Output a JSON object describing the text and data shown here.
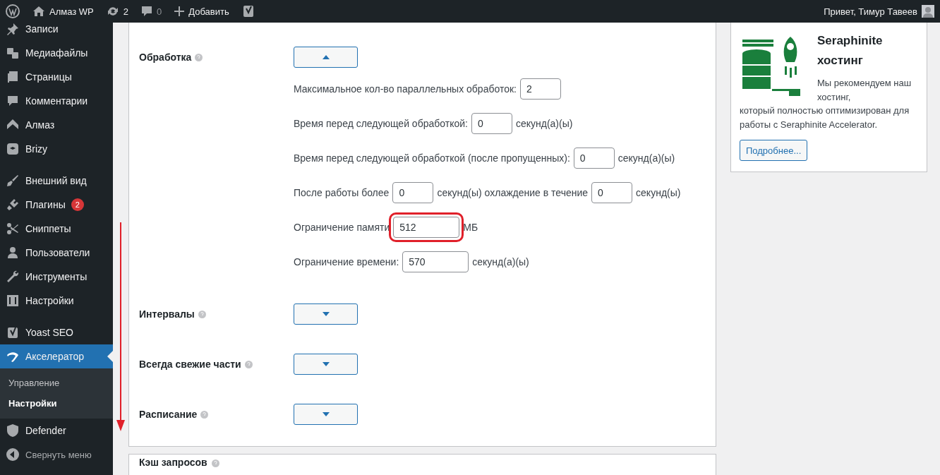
{
  "admin_bar": {
    "site_name": "Алмаз WP",
    "updates": "2",
    "comments": "0",
    "new_label": "Добавить",
    "greeting": "Привет, Тимур Тавеев"
  },
  "sidebar": {
    "sections": [
      {
        "items": [
          {
            "label": "Записи",
            "selected": false
          },
          {
            "label": "Медиафайлы",
            "selected": false
          },
          {
            "label": "Страницы",
            "selected": false
          },
          {
            "label": "Комментарии",
            "selected": false
          },
          {
            "label": "Алмаз",
            "selected": false
          },
          {
            "label": "Brizy",
            "selected": false
          }
        ]
      },
      {
        "items": [
          {
            "label": "Внешний вид",
            "selected": false
          },
          {
            "label": "Плагины",
            "selected": false,
            "badge": "2"
          },
          {
            "label": "Сниппеты",
            "selected": false
          },
          {
            "label": "Пользователи",
            "selected": false
          },
          {
            "label": "Инструменты",
            "selected": false
          },
          {
            "label": "Настройки",
            "selected": false
          }
        ]
      },
      {
        "items": [
          {
            "label": "Yoast SEO",
            "selected": false
          },
          {
            "label": "Акселератор",
            "selected": true,
            "children": [
              {
                "label": "Управление",
                "selected": false
              },
              {
                "label": "Настройки",
                "selected": true
              }
            ]
          },
          {
            "label": "Defender",
            "selected": false
          }
        ]
      }
    ],
    "collapse_label": "Свернуть меню"
  },
  "settings": {
    "groups": [
      {
        "label": "Обработка",
        "expanded": true,
        "fields": [
          {
            "parts": [
              {
                "kind": "text",
                "text": "Максимальное кол-во параллельных обработок:"
              },
              {
                "kind": "input",
                "value": "2",
                "highlighted": false
              }
            ]
          },
          {
            "parts": [
              {
                "kind": "text",
                "text": "Время перед следующей обработкой:"
              },
              {
                "kind": "input",
                "value": "0",
                "highlighted": false
              },
              {
                "kind": "text",
                "text": "секунд(а)(ы)"
              }
            ]
          },
          {
            "parts": [
              {
                "kind": "text",
                "text": "Время перед следующей обработкой (после пропущенных):"
              },
              {
                "kind": "input",
                "value": "0",
                "highlighted": false
              },
              {
                "kind": "text",
                "text": "секунд(а)(ы)"
              }
            ]
          },
          {
            "parts": [
              {
                "kind": "text",
                "text": "После работы более"
              },
              {
                "kind": "input",
                "value": "0",
                "highlighted": false
              },
              {
                "kind": "text",
                "text": "секунд(ы) охлаждение в течение"
              },
              {
                "kind": "input",
                "value": "0",
                "highlighted": false
              },
              {
                "kind": "text",
                "text": "секунд(ы)"
              }
            ]
          },
          {
            "parts": [
              {
                "kind": "text",
                "text": "Ограничение памяти"
              },
              {
                "kind": "input",
                "value": "512",
                "highlighted": true
              },
              {
                "kind": "text",
                "text": "МБ"
              }
            ]
          },
          {
            "parts": [
              {
                "kind": "text",
                "text": "Ограничение времени:"
              },
              {
                "kind": "input",
                "value": "570",
                "highlighted": false
              },
              {
                "kind": "text",
                "text": "секунд(а)(ы)"
              }
            ]
          }
        ]
      },
      {
        "label": "Интервалы",
        "expanded": false
      },
      {
        "label": "Всегда свежие части",
        "expanded": false
      },
      {
        "label": "Расписание",
        "expanded": false
      }
    ]
  },
  "next_panel": {
    "title": "Кэш запросов"
  },
  "promo": {
    "title": "Seraphinite хостинг",
    "text": "Мы рекомендуем наш хостинг, который полностью оптимизирован для работы с Seraphinite Accelerator.",
    "button": "Подробнее..."
  }
}
